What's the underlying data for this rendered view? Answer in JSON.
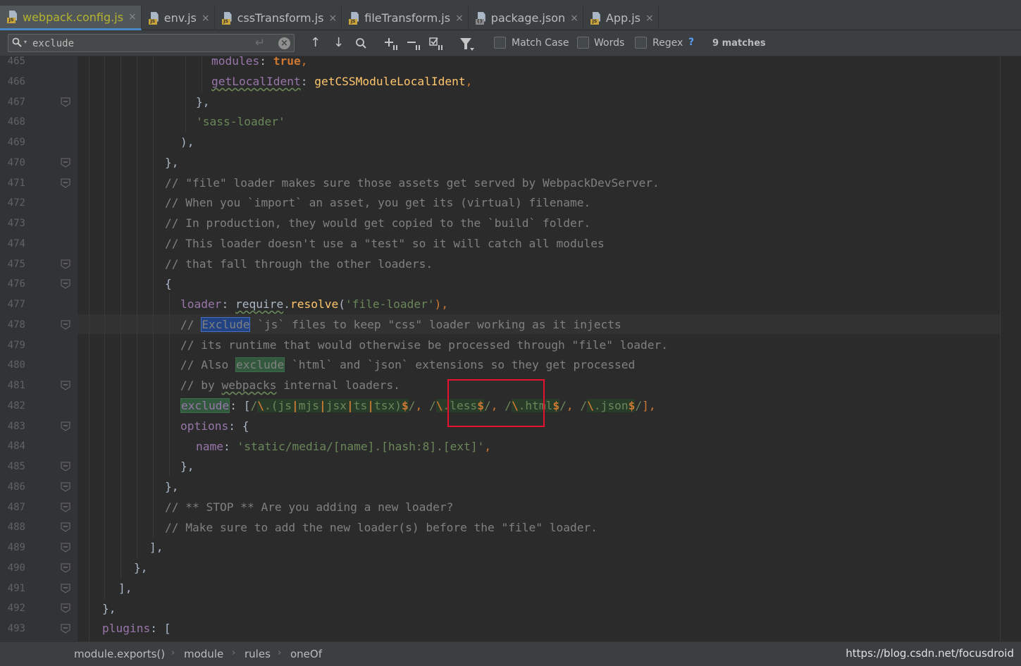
{
  "tabs": [
    {
      "label": "webpack.config.js",
      "icon": "js-file-icon",
      "active": true
    },
    {
      "label": "env.js",
      "icon": "js-file-icon",
      "active": false
    },
    {
      "label": "cssTransform.js",
      "icon": "js-file-icon",
      "active": false
    },
    {
      "label": "fileTransform.js",
      "icon": "js-file-icon",
      "active": false
    },
    {
      "label": "package.json",
      "icon": "json-file-icon",
      "active": false
    },
    {
      "label": "App.js",
      "icon": "js-file-icon",
      "active": false
    }
  ],
  "tab_close": "×",
  "search": {
    "query": "exclude",
    "match_case_label": "Match Case",
    "words_label": "Words",
    "regex_label": "Regex",
    "regex_help": "?",
    "matches": "9 matches"
  },
  "editor": {
    "line_numbers": [
      "465",
      "466",
      "467",
      "468",
      "469",
      "470",
      "471",
      "472",
      "473",
      "474",
      "475",
      "476",
      "477",
      "478",
      "479",
      "480",
      "481",
      "482",
      "483",
      "484",
      "485",
      "486",
      "487",
      "488",
      "489",
      "490",
      "491",
      "492",
      "493"
    ],
    "lines": {
      "l465_a": "modules",
      "l465_b": ": ",
      "l465_c": "true",
      "l465_d": ",",
      "l466_a": "getLocalIdent",
      "l466_b": ": ",
      "l466_c": "getCSSModuleLocalIdent",
      "l466_d": ",",
      "l467": "},",
      "l468": "'sass-loader'",
      "l469": "),",
      "l470": "},",
      "l471": "// \"file\" loader makes sure those assets get served by WebpackDevServer.",
      "l472": "// When you `import` an asset, you get its (virtual) filename.",
      "l473": "// In production, they would get copied to the `build` folder.",
      "l474": "// This loader doesn't use a \"test\" so it will catch all modules",
      "l475": "// that fall through the other loaders.",
      "l476": "{",
      "l477_a": "loader",
      "l477_b": ": ",
      "l477_c": "require",
      "l477_d": ".",
      "l477_e": "resolve",
      "l477_f": "(",
      "l477_g": "'file-loader'",
      "l477_h": "),",
      "l478_a": "// ",
      "l478_b": "Exclude",
      "l478_c": " `js` files to keep \"css\" loader working as it injects",
      "l479": "// its runtime that would otherwise be processed through \"file\" loader.",
      "l480_a": "// Also ",
      "l480_b": "exclude",
      "l480_c": " `html` and `json` extensions so they get processed",
      "l481_a": "// by ",
      "l481_b": "webpacks",
      "l481_c": " internal loaders.",
      "l482_a": "exclude",
      "l482_b": ": [",
      "l482_c": "/",
      "l482_d": "\\",
      "l482_e": ".(js",
      "l482_f": "|",
      "l482_g": "mjs",
      "l482_h": "|",
      "l482_i": "jsx",
      "l482_j": "|",
      "l482_k": "ts",
      "l482_l": "|",
      "l482_m": "tsx)",
      "l482_n": "$",
      "l482_o": "/",
      "l482_p": ", ",
      "l482_q": "/",
      "l482_r": "\\",
      "l482_s": ".less",
      "l482_t": "$",
      "l482_u": "/",
      "l482_v": ", ",
      "l482_w": "/",
      "l482_x": "\\",
      "l482_y": ".html",
      "l482_z": "$",
      "l482_aa": "/",
      "l482_ab": ", ",
      "l482_ac": "/",
      "l482_ad": "\\",
      "l482_ae": ".json",
      "l482_af": "$",
      "l482_ag": "/",
      "l482_ah": "],",
      "l483_a": "options",
      "l483_b": ": {",
      "l484_a": "name",
      "l484_b": ": ",
      "l484_c": "'static/media/[name].[hash:8].[ext]'",
      "l484_d": ",",
      "l485": "},",
      "l486": "},",
      "l487": "// ** STOP ** Are you adding a new loader?",
      "l488": "// Make sure to add the new loader(s) before the \"file\" loader.",
      "l489": "],",
      "l490": "},",
      "l491": "],",
      "l492": "},",
      "l493_a": "plugins",
      "l493_b": ": ["
    }
  },
  "breadcrumb": [
    "module.exports()",
    "module",
    "rules",
    "oneOf"
  ],
  "breadcrumb_sep": "›",
  "watermark": "https://blog.csdn.net/focusdroid",
  "colors": {
    "accent_tab_underline": "#4a88c7",
    "annotation_box": "#e8112d",
    "search_match": "#32593d",
    "current_match": "#214283"
  }
}
